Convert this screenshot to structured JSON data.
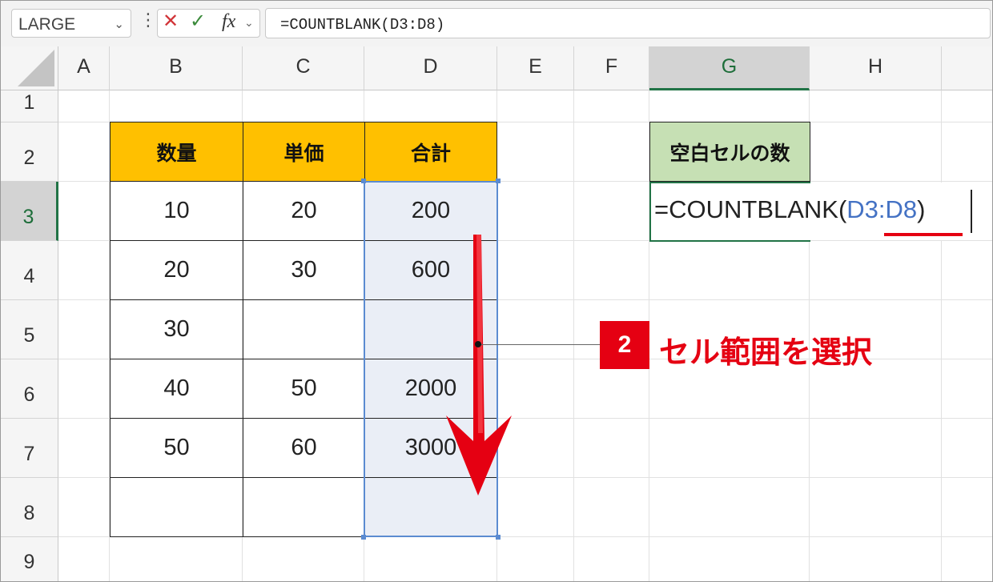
{
  "name_box": {
    "value": "LARGE"
  },
  "formula_bar": {
    "cancel_icon": "close-icon",
    "enter_icon": "check-icon",
    "fx_label": "fx",
    "formula": "=COUNTBLANK(D3:D8)"
  },
  "columns": [
    "A",
    "B",
    "C",
    "D",
    "E",
    "F",
    "G",
    "H"
  ],
  "selected_column": "G",
  "rows": [
    "1",
    "2",
    "3",
    "4",
    "5",
    "6",
    "7",
    "8",
    "9"
  ],
  "selected_row": "3",
  "table": {
    "headers": [
      "数量",
      "単価",
      "合計"
    ],
    "rows": [
      [
        "10",
        "20",
        "200"
      ],
      [
        "20",
        "30",
        "600"
      ],
      [
        "30",
        "",
        ""
      ],
      [
        "40",
        "50",
        "2000"
      ],
      [
        "50",
        "60",
        "3000"
      ],
      [
        "",
        "",
        ""
      ]
    ]
  },
  "result": {
    "header": "空白セルの数",
    "edit_prefix": "=COUNTBLANK(",
    "edit_ref": "D3:D8",
    "edit_suffix": ")"
  },
  "callout": {
    "step": "2",
    "text": "セル範囲を選択"
  },
  "colors": {
    "header_fill": "#ffc000",
    "result_header_fill": "#c6e0b4",
    "accent_red": "#e50012",
    "reference_blue": "#4472c4",
    "excel_green": "#217346"
  }
}
